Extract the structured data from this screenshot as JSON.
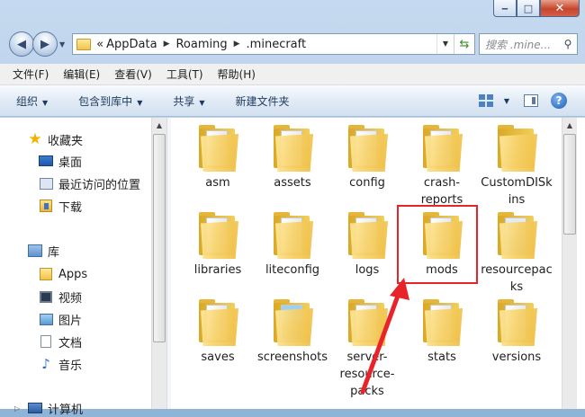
{
  "window": {
    "caption": {
      "minimize": "‒",
      "maximize": "□",
      "close": "✕"
    }
  },
  "address": {
    "overflow": "«",
    "crumbs": [
      "AppData",
      "Roaming",
      ".minecraft"
    ],
    "search_placeholder": "搜索 .mine..."
  },
  "menu": [
    "文件(F)",
    "编辑(E)",
    "查看(V)",
    "工具(T)",
    "帮助(H)"
  ],
  "commands": {
    "organize": "组织",
    "include_in_library": "包含到库中",
    "share": "共享",
    "new_folder": "新建文件夹",
    "help": "?"
  },
  "nav": {
    "favorites": {
      "label": "收藏夹",
      "items": [
        "桌面",
        "最近访问的位置",
        "下载"
      ]
    },
    "libraries": {
      "label": "库",
      "items": [
        "Apps",
        "视频",
        "图片",
        "文档",
        "音乐"
      ]
    },
    "computer": {
      "label": "计算机"
    }
  },
  "files": [
    {
      "name": "asm"
    },
    {
      "name": "assets"
    },
    {
      "name": "config"
    },
    {
      "name": "crash-reports"
    },
    {
      "name": "CustomDISkins"
    },
    {
      "name": "libraries"
    },
    {
      "name": "liteconfig"
    },
    {
      "name": "logs"
    },
    {
      "name": "mods"
    },
    {
      "name": "resourcepacks"
    },
    {
      "name": "saves"
    },
    {
      "name": "screenshots"
    },
    {
      "name": "server-resource-packs"
    },
    {
      "name": "stats"
    },
    {
      "name": "versions"
    }
  ],
  "colors": {
    "highlight": "#e8232a",
    "accent": "#1e395b"
  }
}
